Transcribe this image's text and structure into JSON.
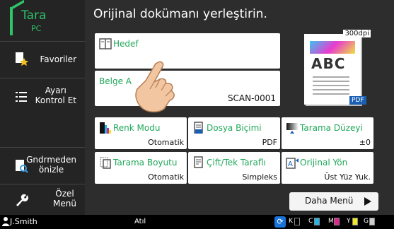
{
  "home": {
    "line1": "Tara",
    "line2": "PC",
    "accent": "#2fc46a"
  },
  "sidebar": {
    "items": [
      {
        "label": "Favoriler",
        "icon": "favorites-icon"
      },
      {
        "label": "Ayarı\nKontrol Et",
        "icon": "list-icon"
      },
      {
        "label": "Gndrmeden\nönizle",
        "icon": "preview-icon"
      },
      {
        "label": "Özel\nMenü",
        "icon": "wrench-icon"
      }
    ]
  },
  "title": "Orijinal dokümanı yerleştirin.",
  "destination": {
    "label": "Hedef"
  },
  "document_name": {
    "label": "Belge A",
    "value": "SCAN-0001"
  },
  "preview": {
    "dpi": "300dpi",
    "text": "ABC",
    "format": "PDF"
  },
  "settings": [
    {
      "label": "Renk Modu",
      "value": "Otomatik",
      "icon": "color-mode-icon"
    },
    {
      "label": "Dosya Biçimi",
      "value": "PDF",
      "icon": "file-format-icon"
    },
    {
      "label": "Tarama Düzeyi",
      "value": "±0",
      "icon": "scan-level-icon"
    },
    {
      "label": "Tarama Boyutu",
      "value": "Otomatik",
      "icon": "scan-size-icon"
    },
    {
      "label": "Çift/Tek Taraflı",
      "value": "Simpleks",
      "icon": "duplex-icon"
    },
    {
      "label": "Orijinal Yön",
      "value": "Üst Yüz Yuk.",
      "icon": "orientation-icon"
    }
  ],
  "more_menu": "Daha Menü",
  "status": {
    "user": "J.Smith",
    "mode": "Atıl",
    "inks": [
      {
        "letter": "K",
        "color": "#000000"
      },
      {
        "letter": "C",
        "color": "#1fb6e8"
      },
      {
        "letter": "M",
        "color": "#e0248c"
      },
      {
        "letter": "Y",
        "color": "#f3e81a"
      },
      {
        "letter": "G",
        "color": "#cccccc"
      }
    ]
  }
}
